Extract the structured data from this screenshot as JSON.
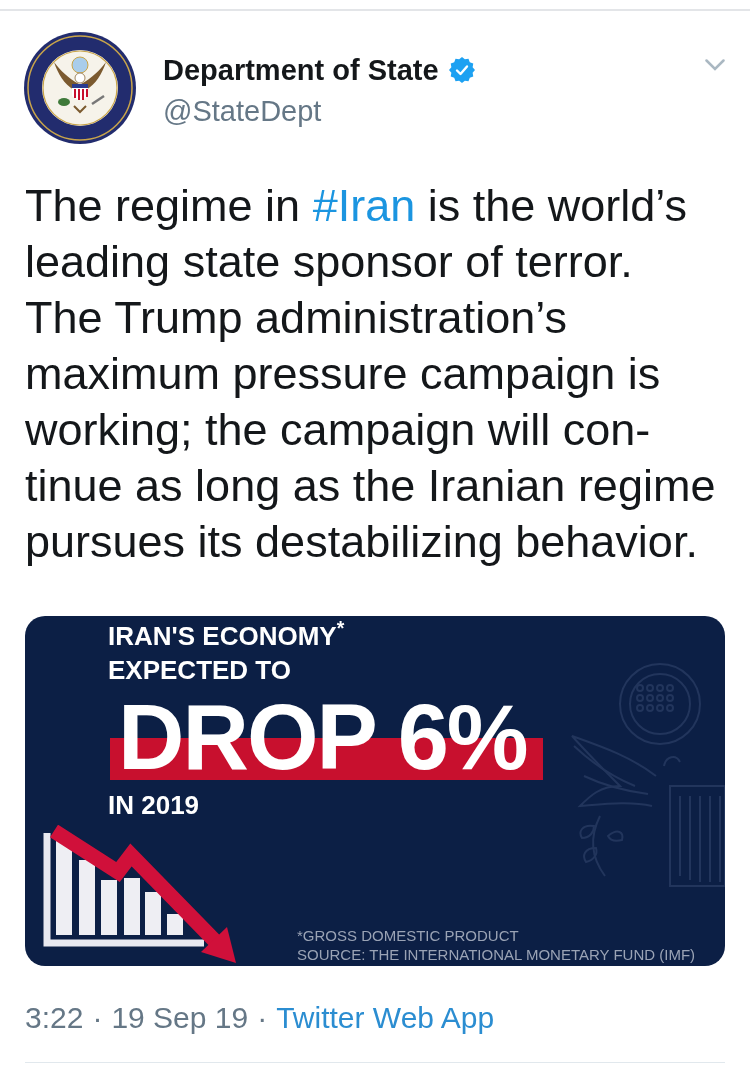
{
  "account": {
    "name": "Department of State",
    "verified": true,
    "handle": "@StateDept"
  },
  "tweet": {
    "parts": [
      {
        "kind": "text",
        "text": "The regime in "
      },
      {
        "kind": "hashtag",
        "text": "#Iran"
      },
      {
        "kind": "text",
        "text": " is the world’s\nleading state sponsor of terror.\nThe Trump administration’s\nmaximum pressure campaign is\nworking; the campaign will con-\ntinue as long as the Iranian regime\npursues its destabilizing behavior."
      }
    ]
  },
  "media": {
    "headline": [
      "IRAN'S ECONOMY$^{*}$",
      "EXPECTED TO"
    ],
    "big_text": "DROP 6%",
    "year": "IN 2019",
    "footnotes": [
      "*GROSS DOMESTIC PRODUCT",
      "SOURCE: THE INTERNATIONAL MONETARY FUND (IMF)"
    ]
  },
  "meta": [
    {
      "kind": "text",
      "text": "3:22"
    },
    {
      "kind": "dot",
      "text": "·"
    },
    {
      "kind": "text",
      "text": "19 Sep 19"
    },
    {
      "kind": "dot",
      "text": "·"
    },
    {
      "kind": "link",
      "text": "Twitter Web App"
    }
  ]
}
